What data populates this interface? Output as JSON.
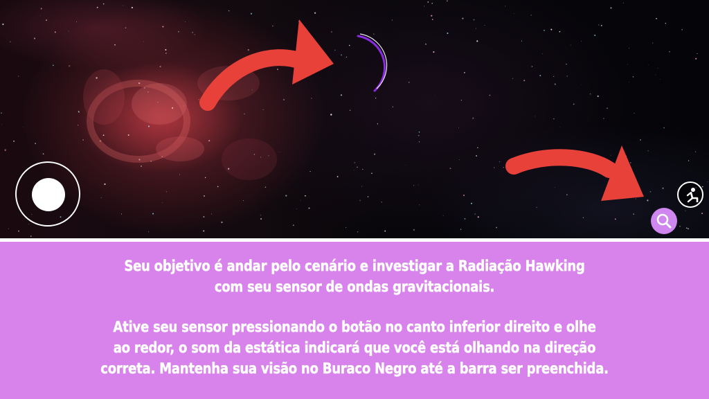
{
  "hud": {
    "joystick_icon": "virtual-joystick",
    "sensor_button_icon": "magnifier-icon",
    "kneel_button_icon": "kneel-icon",
    "sensor_button_color": "#cf86ee",
    "arc_color": "#8a2be2",
    "arrow_color": "#e8413a"
  },
  "instructions": {
    "background_color": "#d883ec",
    "paragraph1": {
      "line1": "Seu objetivo é andar pelo cenário e investigar a Radiação Hawking",
      "line2": "com seu sensor de ondas gravitacionais."
    },
    "paragraph2": {
      "line1": "Ative seu sensor pressionando o botão no canto inferior direito e olhe",
      "line2": "ao redor, o som da estática indicará que você está olhando na direção",
      "line3": "correta. Mantenha sua visão no Buraco Negro até a barra ser preenchida."
    }
  }
}
